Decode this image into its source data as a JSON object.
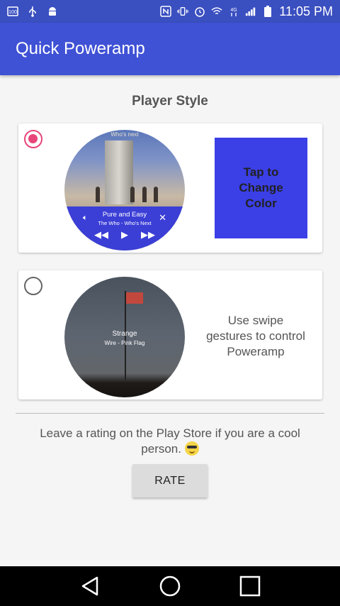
{
  "status_bar": {
    "time": "11:05 PM",
    "left_icons": [
      "notification-100-icon",
      "usb-icon",
      "android-icon"
    ],
    "right_icons": [
      "nfc-icon",
      "vibrate-icon",
      "alarm-icon",
      "wifi-icon",
      "4g-icon",
      "signal-icon",
      "battery-icon"
    ],
    "color": "#3a4fc0"
  },
  "app_bar": {
    "title": "Quick Poweramp",
    "color": "#3f51d5"
  },
  "section_title": "Player Style",
  "style_cards": [
    {
      "selected": true,
      "album_label": "Who's next",
      "song": "Pure and Easy",
      "artist_album": "The Who - Who's Next",
      "color_button_label": "Tap to\nChange\nColor",
      "accent_color": "#3b3fe6"
    },
    {
      "selected": false,
      "song": "Strange",
      "artist_album": "Wire - Pink Flag",
      "description": "Use swipe\ngestures to control\nPoweramp"
    }
  ],
  "rating": {
    "text": "Leave a rating on the Play Store if you are a cool person.",
    "button_label": "RATE"
  },
  "nav_bar": {
    "items": [
      "back-icon",
      "home-icon",
      "recents-icon"
    ]
  },
  "colors": {
    "radio_selected": "#e8457a",
    "primary": "#3f51d5"
  }
}
